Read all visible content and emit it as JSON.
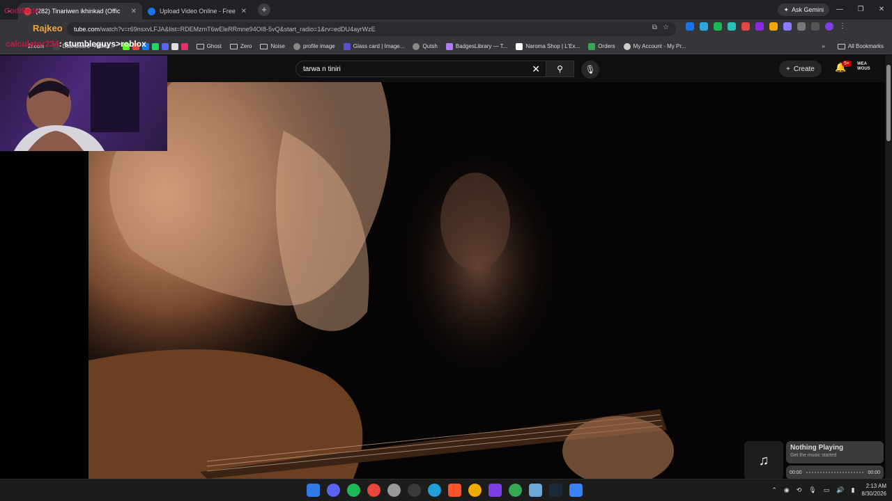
{
  "tabs": [
    {
      "title": "(282) Tinariwen ikhinkad (Offic",
      "active": true
    },
    {
      "title": "Upload Video Online - Free Vid",
      "active": false
    }
  ],
  "gemini_label": "Ask Gemini",
  "url": {
    "host": "tube.com",
    "path": "/watch?v=r69nsxvLFJA&list=RDEMzmT6wEleRRmne94OI8-5vQ&start_radio=1&rv=edDU4ayrWzE"
  },
  "bookmarks": [
    "2i.com",
    "Dashboard - Affiliat...",
    "Ghost",
    "Zero",
    "Noise",
    "profile image",
    "Glass card | Image...",
    "Qutsh",
    "BadgesLibrary — T...",
    "Naroma Shop | L'Ex...",
    "Orders",
    "My Account - My Pr..."
  ],
  "all_bookmarks": "All Bookmarks",
  "overlay": {
    "top_user": "Codifiedx",
    "streamer": "Rajkeo",
    "chat_user": "calculator234",
    "chat_msg": ": stumbleguys>roblox"
  },
  "youtube": {
    "search_query": "tarwa n tiniri",
    "create_label": "Create",
    "notif_count": "9+",
    "avatar_text": "WEA WOUS"
  },
  "music": {
    "title": "Nothing Playing",
    "subtitle": "Get the music started",
    "time_start": "00:00",
    "time_end": "00:00"
  },
  "clock": {
    "time": "2:13 AM",
    "date": "8/30/2026"
  },
  "colors": {
    "accent": "#cc0000",
    "streamer": "#f2a63b",
    "chat_user": "#c41a4a"
  }
}
